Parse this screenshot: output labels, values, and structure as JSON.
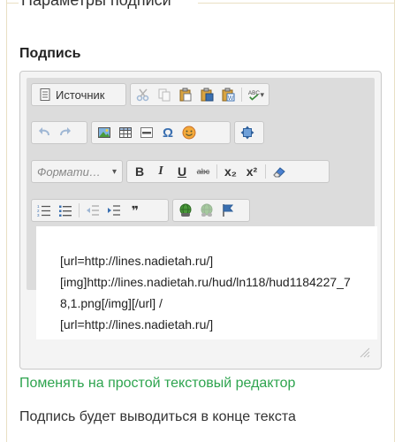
{
  "fieldset": {
    "legend": "Параметры подписи"
  },
  "field": {
    "label": "Подпись"
  },
  "editor": {
    "toolbar": {
      "source_label": "Источник",
      "format_placeholder": "Формати…",
      "format_arrow": "▾",
      "bold": "B",
      "italic": "I",
      "underline": "U",
      "strike": "abc",
      "subscript": "x₂",
      "superscript": "x²",
      "quote": "❞",
      "omega": "Ω"
    },
    "content": "[url=http://lines.nadietah.ru/]\n[img]http://lines.nadietah.ru/hud/ln118/hud1184227_78,1.png[/img][/url] /\n[url=http://lines.nadietah.ru/]"
  },
  "links": {
    "switch_editor": "Поменять на простой текстовый редактор"
  },
  "hint": "Подпись будет выводиться в конце текста",
  "colors": {
    "accent_green": "#2ea44f",
    "fieldset_border": "#e9dfc3",
    "toolbar_bg": "#dcdcdc"
  },
  "icons": [
    "source-icon",
    "cut-icon",
    "copy-icon",
    "paste-icon",
    "paste-text-icon",
    "paste-word-icon",
    "spellcheck-icon",
    "undo-icon",
    "redo-icon",
    "image-icon",
    "table-icon",
    "hr-icon",
    "special-char-icon",
    "smiley-icon",
    "maximize-icon",
    "remove-format-icon",
    "numbered-list-icon",
    "bulleted-list-icon",
    "outdent-icon",
    "indent-icon",
    "link-icon",
    "unlink-icon",
    "anchor-icon",
    "resize-handle-icon"
  ]
}
